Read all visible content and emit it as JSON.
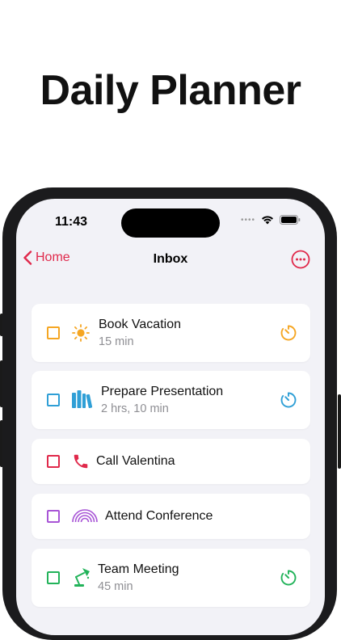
{
  "headline": "Daily Planner",
  "status": {
    "time": "11:43"
  },
  "nav": {
    "back_label": "Home",
    "title": "Inbox"
  },
  "colors": {
    "accent": "#e0294b",
    "background": "#f2f2f7"
  },
  "tasks": [
    {
      "title": "Book Vacation",
      "duration": "15 min",
      "icon": "sun-icon",
      "color": "#f5a623",
      "has_timer": true
    },
    {
      "title": "Prepare Presentation",
      "duration": "2 hrs, 10 min",
      "icon": "books-icon",
      "color": "#2f9fd6",
      "has_timer": true
    },
    {
      "title": "Call Valentina",
      "duration": "",
      "icon": "phone-icon",
      "color": "#e0294b",
      "has_timer": false
    },
    {
      "title": "Attend Conference",
      "duration": "",
      "icon": "rainbow-icon",
      "color": "#a855d6",
      "has_timer": false
    },
    {
      "title": "Team Meeting",
      "duration": "45 min",
      "icon": "desk-lamp-icon",
      "color": "#22b35a",
      "has_timer": true
    }
  ]
}
